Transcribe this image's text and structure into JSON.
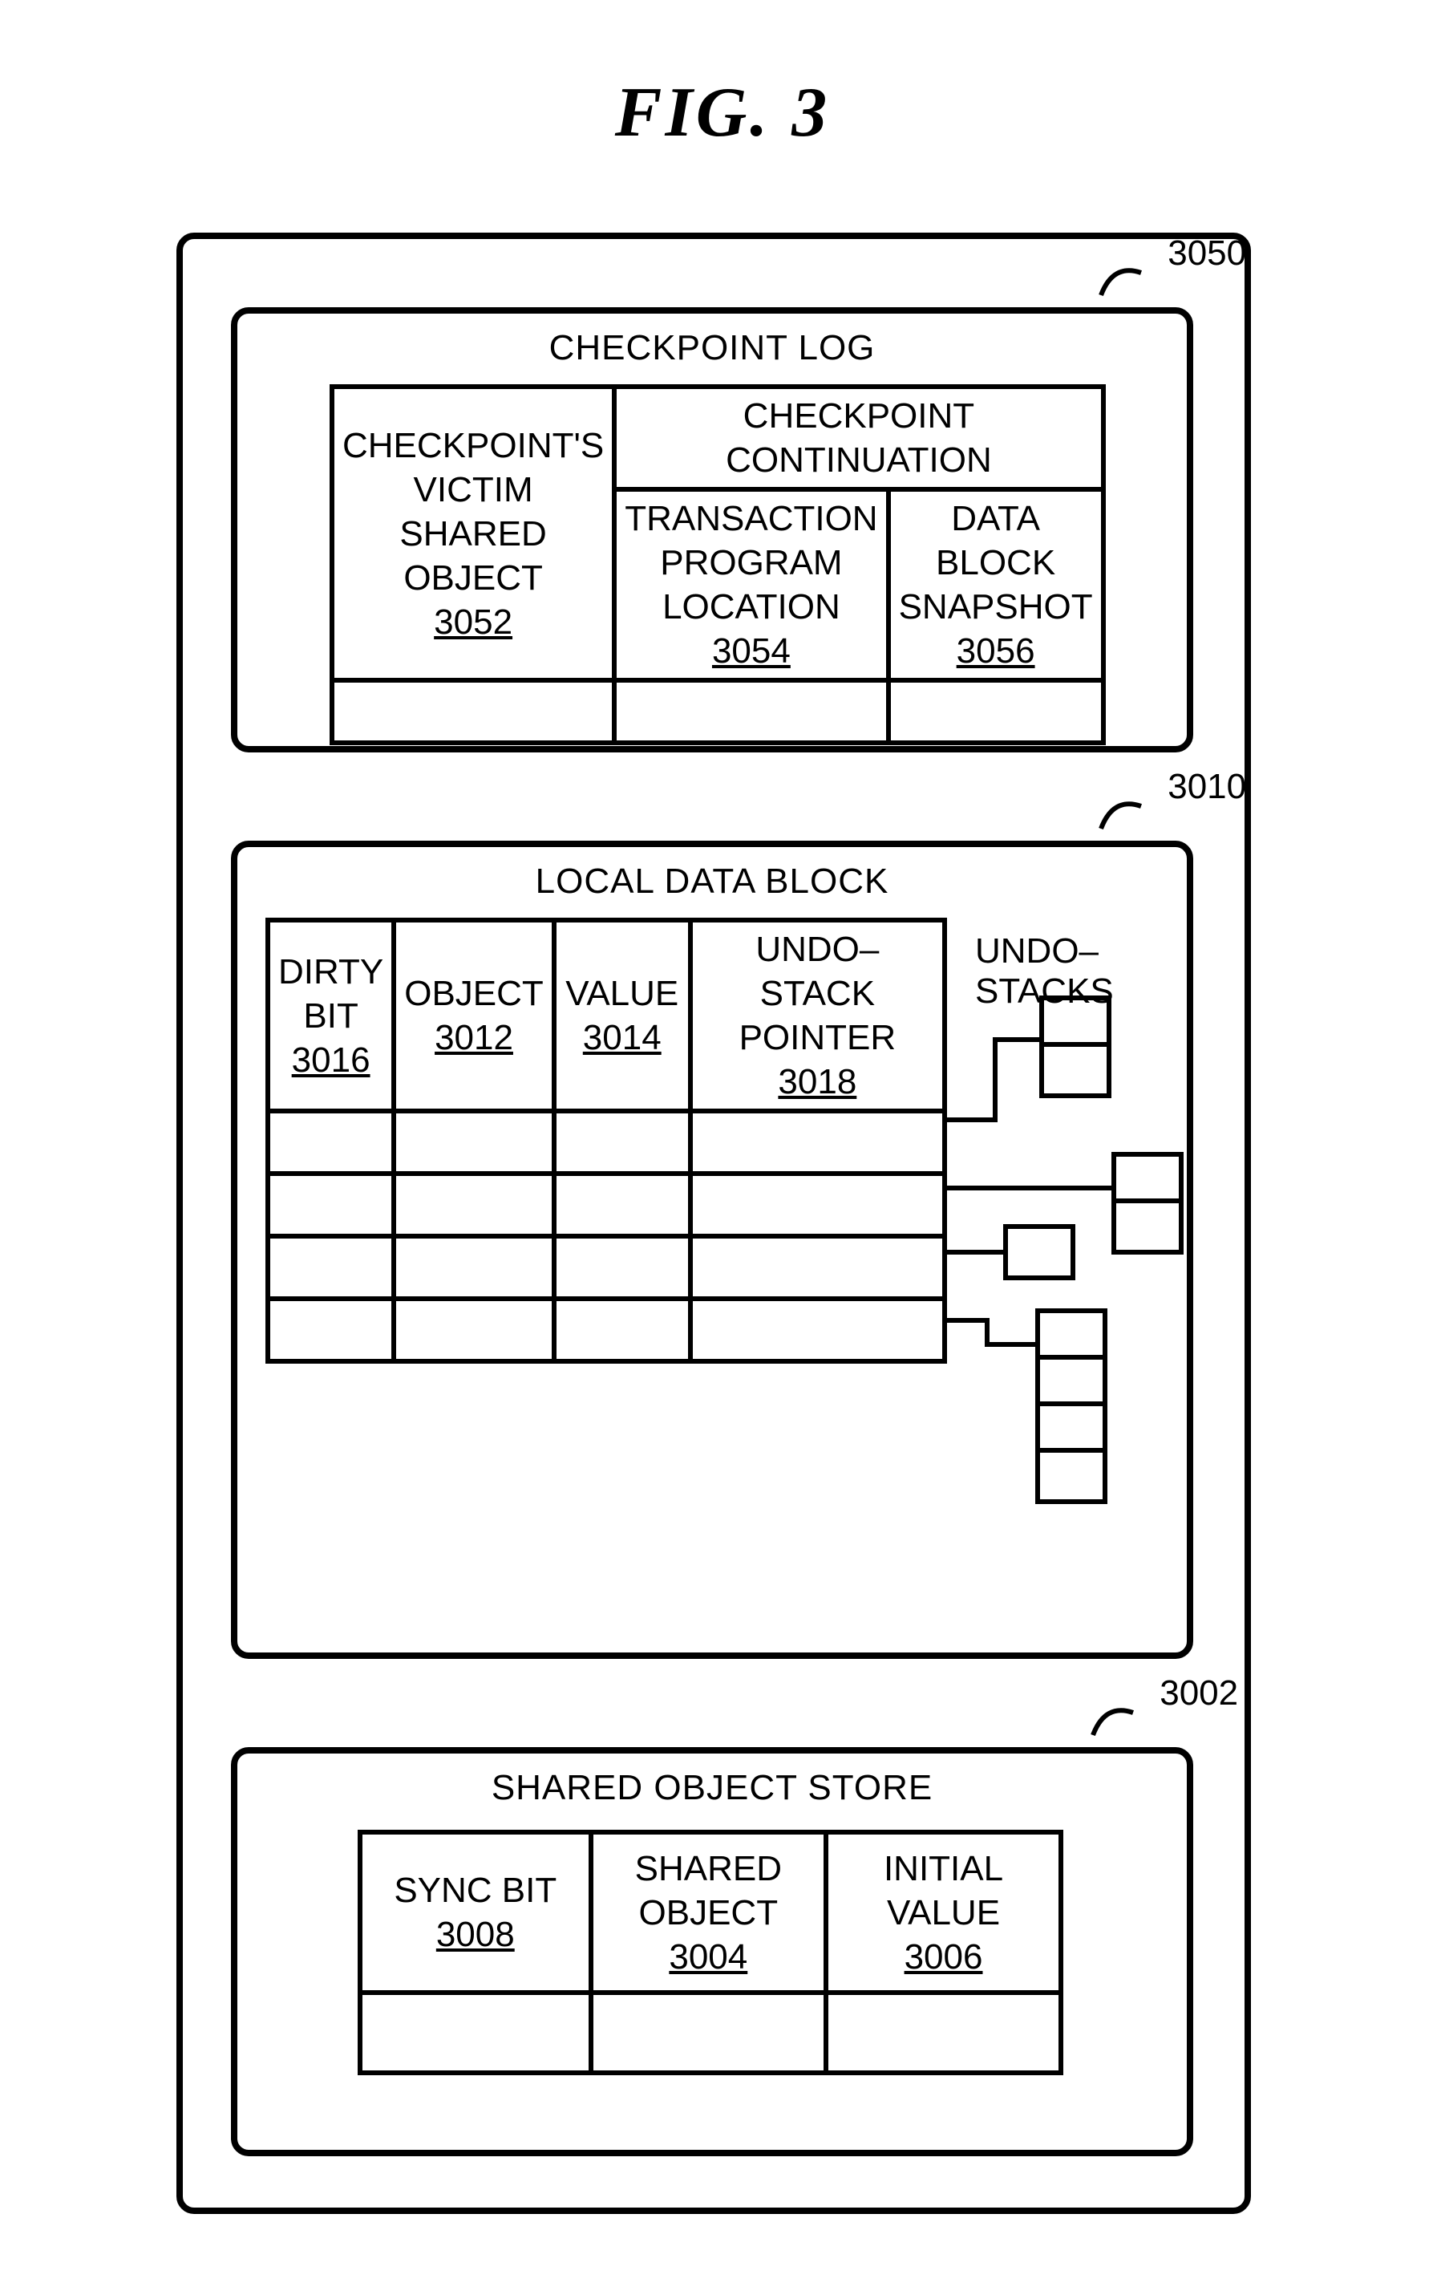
{
  "figure_label": "FIG.  3",
  "refs": {
    "checkpoint_log": "3050",
    "local_data_block": "3010",
    "shared_object_store": "3002"
  },
  "checkpoint_log": {
    "title": "CHECKPOINT LOG",
    "victim_label_l1": "CHECKPOINT'S",
    "victim_label_l2": "VICTIM SHARED",
    "victim_label_l3": "OBJECT",
    "victim_ref": "3052",
    "continuation_header": "CHECKPOINT CONTINUATION",
    "txn_loc_l1": "TRANSACTION",
    "txn_loc_l2": "PROGRAM",
    "txn_loc_l3": "LOCATION",
    "txn_loc_ref": "3054",
    "snapshot_l1": "DATA",
    "snapshot_l2": "BLOCK",
    "snapshot_l3": "SNAPSHOT",
    "snapshot_ref": "3056"
  },
  "local_data_block": {
    "title": "LOCAL DATA BLOCK",
    "dirty_bit_l1": "DIRTY",
    "dirty_bit_l2": "BIT",
    "dirty_bit_ref": "3016",
    "object_label": "OBJECT",
    "object_ref": "3012",
    "value_label": "VALUE",
    "value_ref": "3014",
    "undo_ptr_l1": "UNDO–STACK",
    "undo_ptr_l2": "POINTER",
    "undo_ptr_ref": "3018",
    "undo_stacks_label": "UNDO–STACKS"
  },
  "shared_object_store": {
    "title": "SHARED OBJECT STORE",
    "sync_bit_label": "SYNC BIT",
    "sync_bit_ref": "3008",
    "shared_obj_l1": "SHARED",
    "shared_obj_l2": "OBJECT",
    "shared_obj_ref": "3004",
    "initial_val_l1": "INITIAL",
    "initial_val_l2": "VALUE",
    "initial_val_ref": "3006"
  },
  "chart_data": {
    "type": "table",
    "description": "Patent-style block diagram of transactional-memory data structures",
    "blocks": [
      {
        "name": "CHECKPOINT LOG",
        "ref": "3050",
        "columns": [
          {
            "name": "CHECKPOINT'S VICTIM SHARED OBJECT",
            "ref": "3052"
          },
          {
            "group": "CHECKPOINT CONTINUATION",
            "columns": [
              {
                "name": "TRANSACTION PROGRAM LOCATION",
                "ref": "3054"
              },
              {
                "name": "DATA BLOCK SNAPSHOT",
                "ref": "3056"
              }
            ]
          }
        ],
        "body_rows": 1
      },
      {
        "name": "LOCAL DATA BLOCK",
        "ref": "3010",
        "columns": [
          {
            "name": "DIRTY BIT",
            "ref": "3016"
          },
          {
            "name": "OBJECT",
            "ref": "3012"
          },
          {
            "name": "VALUE",
            "ref": "3014"
          },
          {
            "name": "UNDO–STACK POINTER",
            "ref": "3018"
          }
        ],
        "body_rows": 4,
        "side_label": "UNDO–STACKS",
        "undo_stacks": [
          {
            "from_row": 1,
            "cells": 2
          },
          {
            "from_row": 2,
            "cells": 2
          },
          {
            "from_row": 3,
            "cells": 1
          },
          {
            "from_row": 4,
            "cells": 4
          }
        ]
      },
      {
        "name": "SHARED OBJECT STORE",
        "ref": "3002",
        "columns": [
          {
            "name": "SYNC BIT",
            "ref": "3008"
          },
          {
            "name": "SHARED OBJECT",
            "ref": "3004"
          },
          {
            "name": "INITIAL VALUE",
            "ref": "3006"
          }
        ],
        "body_rows": 1
      }
    ]
  }
}
